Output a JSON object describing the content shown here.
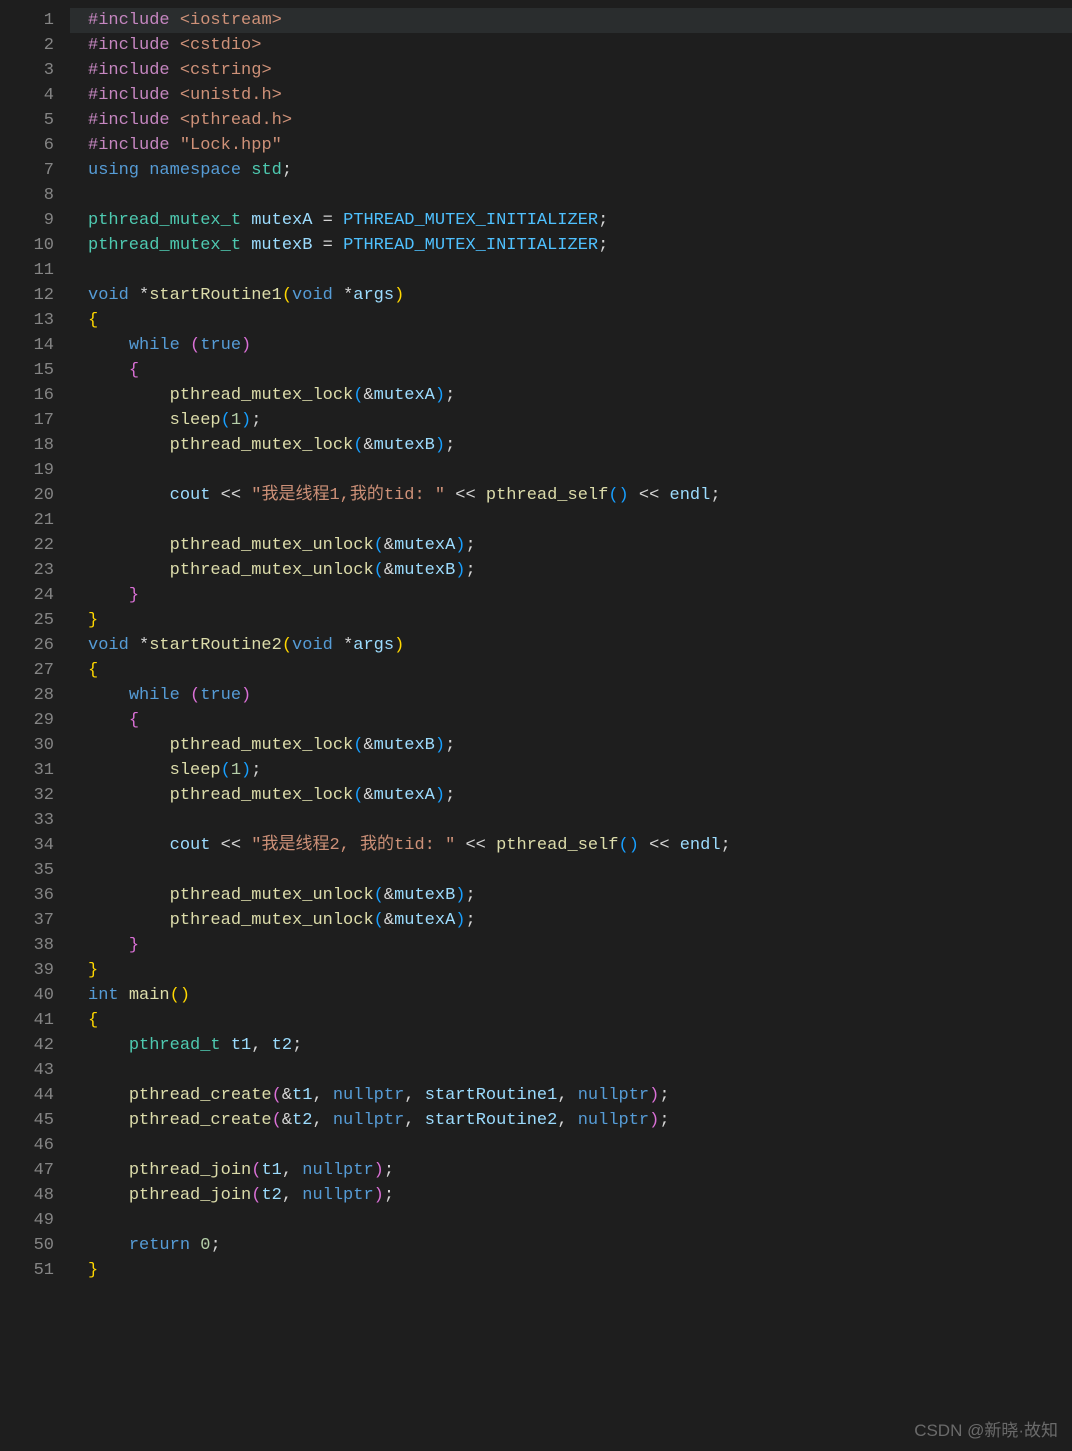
{
  "watermark": "CSDN @新晓·故知",
  "lines": [
    {
      "n": 1,
      "html": "<span class='preproc'>#include</span> <span class='string'>&lt;iostream&gt;</span>",
      "hl": true
    },
    {
      "n": 2,
      "html": "<span class='preproc'>#include</span> <span class='string'>&lt;cstdio&gt;</span>"
    },
    {
      "n": 3,
      "html": "<span class='preproc'>#include</span> <span class='string'>&lt;cstring&gt;</span>"
    },
    {
      "n": 4,
      "html": "<span class='preproc'>#include</span> <span class='string'>&lt;unistd.h&gt;</span>"
    },
    {
      "n": 5,
      "html": "<span class='preproc'>#include</span> <span class='string'>&lt;pthread.h&gt;</span>"
    },
    {
      "n": 6,
      "html": "<span class='preproc'>#include</span> <span class='string'>\"Lock.hpp\"</span>"
    },
    {
      "n": 7,
      "html": "<span class='keyword'>using</span> <span class='keyword'>namespace</span> <span class='type'>std</span><span class='punct'>;</span>"
    },
    {
      "n": 8,
      "html": ""
    },
    {
      "n": 9,
      "html": "<span class='type'>pthread_mutex_t</span> <span class='var'>mutexA</span> <span class='op'>=</span> <span class='const'>PTHREAD_MUTEX_INITIALIZER</span><span class='punct'>;</span>"
    },
    {
      "n": 10,
      "html": "<span class='type'>pthread_mutex_t</span> <span class='var'>mutexB</span> <span class='op'>=</span> <span class='const'>PTHREAD_MUTEX_INITIALIZER</span><span class='punct'>;</span>"
    },
    {
      "n": 11,
      "html": ""
    },
    {
      "n": 12,
      "html": "<span class='keyword'>void</span> <span class='op'>*</span><span class='func'>startRoutine1</span><span class='brace'>(</span><span class='keyword'>void</span> <span class='op'>*</span><span class='var'>args</span><span class='brace'>)</span>"
    },
    {
      "n": 13,
      "html": "<span class='brace'>{</span>"
    },
    {
      "n": 14,
      "html": "    <span class='keyword'>while</span> <span class='brace2'>(</span><span class='keyword'>true</span><span class='brace2'>)</span>"
    },
    {
      "n": 15,
      "html": "    <span class='brace2'>{</span>"
    },
    {
      "n": 16,
      "html": "        <span class='func'>pthread_mutex_lock</span><span class='brace3'>(</span><span class='op'>&amp;</span><span class='var'>mutexA</span><span class='brace3'>)</span><span class='punct'>;</span>"
    },
    {
      "n": 17,
      "html": "        <span class='func'>sleep</span><span class='brace3'>(</span><span class='num'>1</span><span class='brace3'>)</span><span class='punct'>;</span>"
    },
    {
      "n": 18,
      "html": "        <span class='func'>pthread_mutex_lock</span><span class='brace3'>(</span><span class='op'>&amp;</span><span class='var'>mutexB</span><span class='brace3'>)</span><span class='punct'>;</span>"
    },
    {
      "n": 19,
      "html": ""
    },
    {
      "n": 20,
      "html": "        <span class='var'>cout</span> <span class='op'>&lt;&lt;</span> <span class='string'>\"我是线程1,我的tid: \"</span> <span class='op'>&lt;&lt;</span> <span class='func'>pthread_self</span><span class='brace3'>(</span><span class='brace3'>)</span> <span class='op'>&lt;&lt;</span> <span class='var'>endl</span><span class='punct'>;</span>"
    },
    {
      "n": 21,
      "html": ""
    },
    {
      "n": 22,
      "html": "        <span class='func'>pthread_mutex_unlock</span><span class='brace3'>(</span><span class='op'>&amp;</span><span class='var'>mutexA</span><span class='brace3'>)</span><span class='punct'>;</span>"
    },
    {
      "n": 23,
      "html": "        <span class='func'>pthread_mutex_unlock</span><span class='brace3'>(</span><span class='op'>&amp;</span><span class='var'>mutexB</span><span class='brace3'>)</span><span class='punct'>;</span>"
    },
    {
      "n": 24,
      "html": "    <span class='brace2'>}</span>"
    },
    {
      "n": 25,
      "html": "<span class='brace'>}</span>"
    },
    {
      "n": 26,
      "html": "<span class='keyword'>void</span> <span class='op'>*</span><span class='func'>startRoutine2</span><span class='brace'>(</span><span class='keyword'>void</span> <span class='op'>*</span><span class='var'>args</span><span class='brace'>)</span>"
    },
    {
      "n": 27,
      "html": "<span class='brace'>{</span>"
    },
    {
      "n": 28,
      "html": "    <span class='keyword'>while</span> <span class='brace2'>(</span><span class='keyword'>true</span><span class='brace2'>)</span>"
    },
    {
      "n": 29,
      "html": "    <span class='brace2'>{</span>"
    },
    {
      "n": 30,
      "html": "        <span class='func'>pthread_mutex_lock</span><span class='brace3'>(</span><span class='op'>&amp;</span><span class='var'>mutexB</span><span class='brace3'>)</span><span class='punct'>;</span>"
    },
    {
      "n": 31,
      "html": "        <span class='func'>sleep</span><span class='brace3'>(</span><span class='num'>1</span><span class='brace3'>)</span><span class='punct'>;</span>"
    },
    {
      "n": 32,
      "html": "        <span class='func'>pthread_mutex_lock</span><span class='brace3'>(</span><span class='op'>&amp;</span><span class='var'>mutexA</span><span class='brace3'>)</span><span class='punct'>;</span>"
    },
    {
      "n": 33,
      "html": ""
    },
    {
      "n": 34,
      "html": "        <span class='var'>cout</span> <span class='op'>&lt;&lt;</span> <span class='string'>\"我是线程2, 我的tid: \"</span> <span class='op'>&lt;&lt;</span> <span class='func'>pthread_self</span><span class='brace3'>(</span><span class='brace3'>)</span> <span class='op'>&lt;&lt;</span> <span class='var'>endl</span><span class='punct'>;</span>"
    },
    {
      "n": 35,
      "html": ""
    },
    {
      "n": 36,
      "html": "        <span class='func'>pthread_mutex_unlock</span><span class='brace3'>(</span><span class='op'>&amp;</span><span class='var'>mutexB</span><span class='brace3'>)</span><span class='punct'>;</span>"
    },
    {
      "n": 37,
      "html": "        <span class='func'>pthread_mutex_unlock</span><span class='brace3'>(</span><span class='op'>&amp;</span><span class='var'>mutexA</span><span class='brace3'>)</span><span class='punct'>;</span>"
    },
    {
      "n": 38,
      "html": "    <span class='brace2'>}</span>"
    },
    {
      "n": 39,
      "html": "<span class='brace'>}</span>"
    },
    {
      "n": 40,
      "html": "<span class='keyword'>int</span> <span class='func'>main</span><span class='brace'>(</span><span class='brace'>)</span>"
    },
    {
      "n": 41,
      "html": "<span class='brace'>{</span>"
    },
    {
      "n": 42,
      "html": "    <span class='type'>pthread_t</span> <span class='var'>t1</span><span class='punct'>,</span> <span class='var'>t2</span><span class='punct'>;</span>"
    },
    {
      "n": 43,
      "html": ""
    },
    {
      "n": 44,
      "html": "    <span class='func'>pthread_create</span><span class='brace2'>(</span><span class='op'>&amp;</span><span class='var'>t1</span><span class='punct'>,</span> <span class='keyword'>nullptr</span><span class='punct'>,</span> <span class='var'>startRoutine1</span><span class='punct'>,</span> <span class='keyword'>nullptr</span><span class='brace2'>)</span><span class='punct'>;</span>"
    },
    {
      "n": 45,
      "html": "    <span class='func'>pthread_create</span><span class='brace2'>(</span><span class='op'>&amp;</span><span class='var'>t2</span><span class='punct'>,</span> <span class='keyword'>nullptr</span><span class='punct'>,</span> <span class='var'>startRoutine2</span><span class='punct'>,</span> <span class='keyword'>nullptr</span><span class='brace2'>)</span><span class='punct'>;</span>"
    },
    {
      "n": 46,
      "html": ""
    },
    {
      "n": 47,
      "html": "    <span class='func'>pthread_join</span><span class='brace2'>(</span><span class='var'>t1</span><span class='punct'>,</span> <span class='keyword'>nullptr</span><span class='brace2'>)</span><span class='punct'>;</span>"
    },
    {
      "n": 48,
      "html": "    <span class='func'>pthread_join</span><span class='brace2'>(</span><span class='var'>t2</span><span class='punct'>,</span> <span class='keyword'>nullptr</span><span class='brace2'>)</span><span class='punct'>;</span>"
    },
    {
      "n": 49,
      "html": ""
    },
    {
      "n": 50,
      "html": "    <span class='keyword'>return</span> <span class='num'>0</span><span class='punct'>;</span>"
    },
    {
      "n": 51,
      "html": "<span class='brace'>}</span>"
    }
  ]
}
